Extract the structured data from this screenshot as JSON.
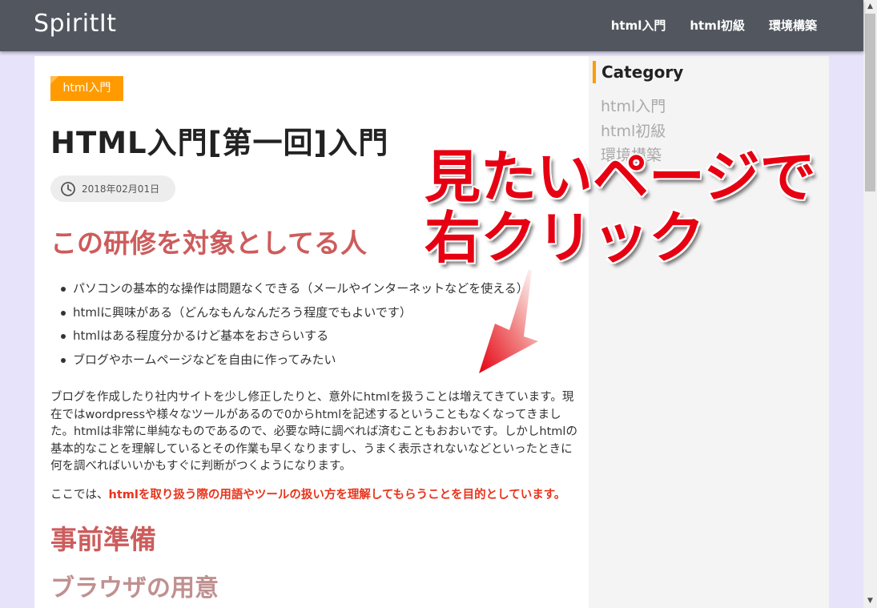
{
  "header": {
    "brand": "SpiritIt",
    "nav": [
      "html入門",
      "html初級",
      "環境構築"
    ]
  },
  "post": {
    "category": "html入門",
    "title": "HTML入門[第一回]入門",
    "date": "2018年02月01日",
    "section1_heading": "この研修を対象としてる人",
    "bullets": [
      "パソコンの基本的な操作は問題なくできる（メールやインターネットなどを使える）",
      "htmlに興味がある（どんなもんなんだろう程度でもよいです）",
      "htmlはある程度分かるけど基本をおさらいする",
      "ブログやホームページなどを自由に作ってみたい"
    ],
    "paragraph": "ブログを作成したり社内サイトを少し修正したりと、意外にhtmlを扱うことは増えてきています。現在ではwordpressや様々なツールがあるので0からhtmlを記述するということもなくなってきました。htmlは非常に単純なものであるので、必要な時に調べれば済むこともおおいです。しかしhtmlの基本的なことを理解しているとその作業も早くなりますし、うまく表示されないなどといったときに何を調べればいいかもすぐに判断がつくようになります。",
    "purpose_prefix": "ここでは、",
    "purpose_emphasis": "htmlを取り扱う際の用語やツールの扱い方を理解してもらうことを目的としています。",
    "section2_heading": "事前準備",
    "section3_heading": "ブラウザの用意"
  },
  "sidebar": {
    "title": "Category",
    "items": [
      "html入門",
      "html初級",
      "環境構築"
    ]
  },
  "annotation": {
    "line1": "見たいページで",
    "line2": "右クリック"
  },
  "colors": {
    "header_bg": "#52575f",
    "accent_orange": "#ff9b00",
    "heading_red": "#cd5c5c",
    "annotation_red": "#e60012",
    "emphasis_red": "#e8341c"
  },
  "icons": [
    "clock-icon",
    "arrow-icon",
    "scroll-up-icon",
    "scroll-down-icon"
  ]
}
